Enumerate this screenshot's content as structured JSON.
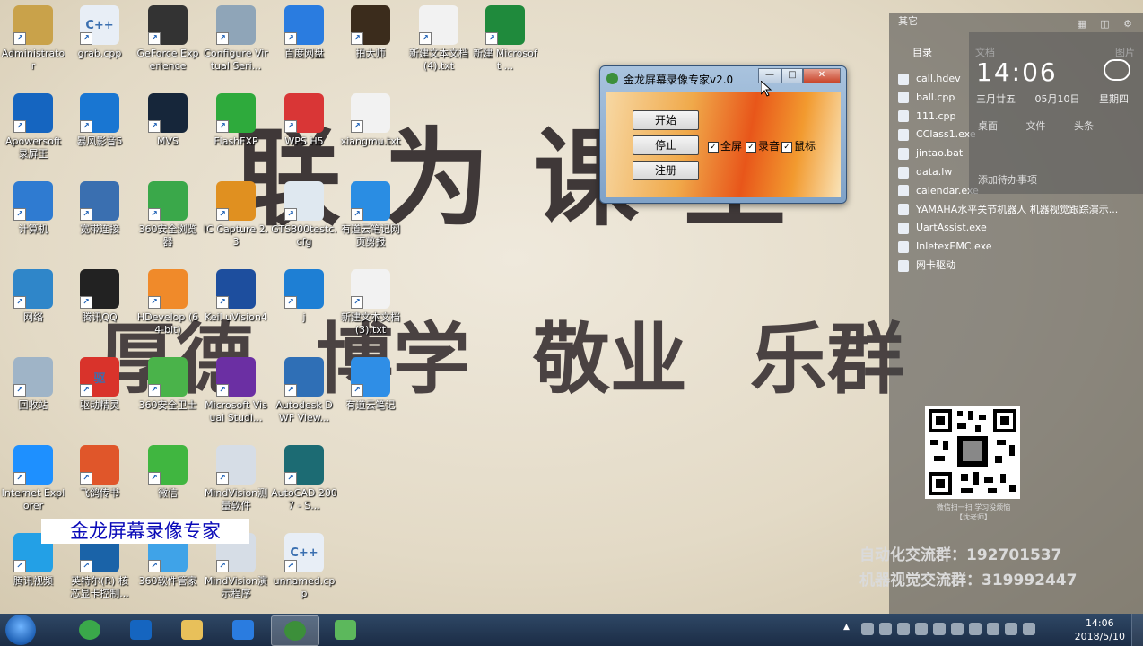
{
  "wallpaper": {
    "title_line": "联为课堂",
    "motto": "厚德 博学 敬业 乐群",
    "groups": [
      "自动化交流群：192701537",
      "机器视觉交流群：319992447"
    ],
    "qr_caption": [
      "微信扫一扫 学习没烦恼",
      "【沈老师】"
    ]
  },
  "desktop_icons": [
    {
      "label": "Administrator",
      "color": "#c9a24a"
    },
    {
      "label": "grab.cpp",
      "color": "#e8eef6",
      "text": "C++"
    },
    {
      "label": "GeForce Experience",
      "color": "#333333"
    },
    {
      "label": "Configure Virtual Seri...",
      "color": "#8fa5b8"
    },
    {
      "label": "百度网盘",
      "color": "#2a7ce0"
    },
    {
      "label": "拍大师",
      "color": "#3b2c1c"
    },
    {
      "label": "新建文本文档 (4).txt",
      "color": "#f2f2f2"
    },
    {
      "label": "新建 Microsoft ...",
      "color": "#1f8a3c"
    },
    {
      "label": "Apowersoft 录屏王",
      "color": "#1565c0"
    },
    {
      "label": "暴风影音5",
      "color": "#1976d2"
    },
    {
      "label": "MVS",
      "color": "#16263a"
    },
    {
      "label": "FlashFXP",
      "color": "#2eaa3c"
    },
    {
      "label": "WPS H5",
      "color": "#d93636"
    },
    {
      "label": "xiangmu.txt",
      "color": "#f2f2f2"
    },
    {
      "label": "计算机",
      "color": "#2f7bd1"
    },
    {
      "label": "宽带连接",
      "color": "#3a6fb0"
    },
    {
      "label": "360安全浏览器",
      "color": "#3aa84a"
    },
    {
      "label": "IC Capture 2.3",
      "color": "#e09020"
    },
    {
      "label": "GTS800testc.cfg",
      "color": "#dfe8f0"
    },
    {
      "label": "有道云笔记网页剪报",
      "color": "#2a8de3"
    },
    {
      "label": "网络",
      "color": "#2f86c9"
    },
    {
      "label": "腾讯QQ",
      "color": "#222222"
    },
    {
      "label": "HDevelop (64-bit)",
      "color": "#f08a2a"
    },
    {
      "label": "Keil uVision4",
      "color": "#1d4e9e"
    },
    {
      "label": "j",
      "color": "#1e7fd4"
    },
    {
      "label": "新建文本文档 (3).txt",
      "color": "#f2f2f2"
    },
    {
      "label": "回收站",
      "color": "#9fb4c7"
    },
    {
      "label": "驱动精灵",
      "color": "#d9332b",
      "text": "驱"
    },
    {
      "label": "360安全卫士",
      "color": "#4ab34a"
    },
    {
      "label": "Microsoft Visual Studi...",
      "color": "#6b2fa3"
    },
    {
      "label": "Autodesk DWF View...",
      "color": "#2f6fb6"
    },
    {
      "label": "有道云笔记",
      "color": "#2f8ee6"
    },
    {
      "label": "Internet Explorer",
      "color": "#1e90ff"
    },
    {
      "label": "飞鸽传书",
      "color": "#e0562a"
    },
    {
      "label": "微信",
      "color": "#40b640"
    },
    {
      "label": "MindVision测量软件",
      "color": "#d6dde6"
    },
    {
      "label": "AutoCAD 2007 - S...",
      "color": "#1c6b73"
    },
    {
      "label": "腾讯视频",
      "color": "#23a0e6"
    },
    {
      "label": "英特尔(R) 核芯显卡控制...",
      "color": "#1a63a8"
    },
    {
      "label": "360软件管家",
      "color": "#3fa3e8"
    },
    {
      "label": "MindVision演示程序",
      "color": "#d6dde6"
    },
    {
      "label": "unnamed.cpp",
      "color": "#e8eef6",
      "text": "C++"
    }
  ],
  "side_panel": {
    "header": "其它",
    "tabs": [
      "目录",
      "文档",
      "图片"
    ],
    "files": [
      "call.hdev",
      "ball.cpp",
      "111.cpp",
      "CClass1.exe",
      "jintao.bat",
      "data.lw",
      "calendar.exe",
      "YAMAHA水平关节机器人 机器视觉跟踪演示...",
      "UartAssist.exe",
      "InletexEMC.exe",
      "网卡驱动"
    ]
  },
  "widget": {
    "time": "14:06",
    "lunar": "三月廿五",
    "date": "05月10日",
    "weekday": "星期四",
    "row1": "桌面 文件 头条",
    "row2": "添加待办事项"
  },
  "recorder_dialog": {
    "title": "金龙屏幕录像专家v2.0",
    "buttons": {
      "start": "开始",
      "stop": "停止",
      "register": "注册"
    },
    "checkboxes": [
      {
        "label": "全屏",
        "checked": true
      },
      {
        "label": "录音",
        "checked": true
      },
      {
        "label": "鼠标",
        "checked": true
      }
    ],
    "window_controls": {
      "minimize": "—",
      "maximize": "□",
      "close": "✕"
    }
  },
  "caption_banner": "金龙屏幕录像专家",
  "taskbar": {
    "items": [
      "360安全浏览器",
      "视频",
      "资源管理器",
      "WPS",
      "金龙屏幕录像专家",
      "记事本"
    ],
    "active_index": 4,
    "clock_time": "14:06",
    "clock_date": "2018/5/10"
  }
}
